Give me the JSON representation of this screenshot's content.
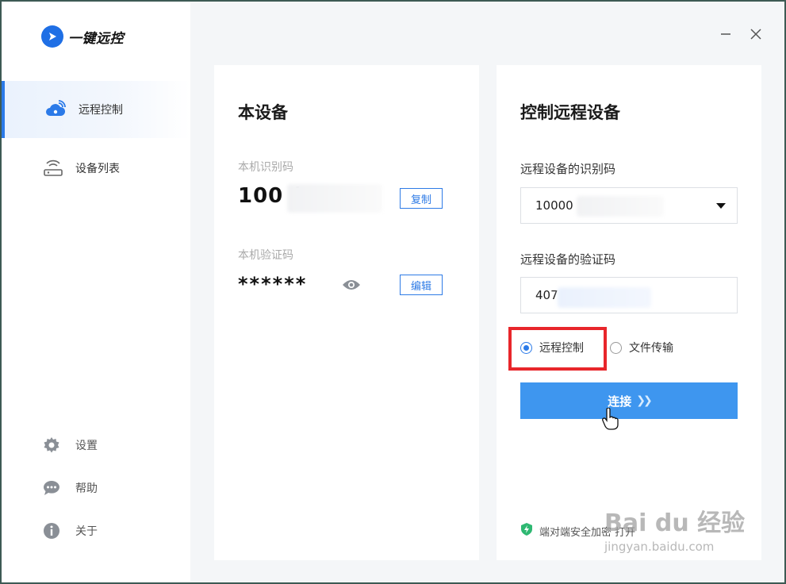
{
  "app": {
    "name": "一键远控"
  },
  "window_controls": {
    "minimize": "—",
    "close": "✕"
  },
  "sidebar": {
    "items": [
      {
        "label": "远程控制",
        "icon": "cloud-remote-icon",
        "active": true
      },
      {
        "label": "设备列表",
        "icon": "router-icon",
        "active": false
      }
    ],
    "bottom_items": [
      {
        "label": "设置",
        "icon": "gear-icon"
      },
      {
        "label": "帮助",
        "icon": "chat-help-icon"
      },
      {
        "label": "关于",
        "icon": "info-icon"
      }
    ]
  },
  "local_device": {
    "title": "本设备",
    "id_label": "本机识别码",
    "id_value": "100 (",
    "copy_label": "复制",
    "verify_label": "本机验证码",
    "verify_value": "******",
    "edit_label": "编辑"
  },
  "remote_device": {
    "title": "控制远程设备",
    "id_label": "远程设备的识别码",
    "id_value": "10000",
    "verify_label": "远程设备的验证码",
    "verify_value": "407",
    "mode_options": [
      {
        "label": "远程控制",
        "checked": true
      },
      {
        "label": "文件传输",
        "checked": false
      }
    ],
    "connect_label": "连接",
    "security_note": "端对端安全加密 打开"
  },
  "watermark": {
    "brand": "Bai du 经验",
    "url": "jingyan.baidu.com"
  },
  "colors": {
    "accent": "#2b7ae8",
    "button": "#3e96ef",
    "highlight": "#e8262b",
    "shield": "#2eb872"
  }
}
